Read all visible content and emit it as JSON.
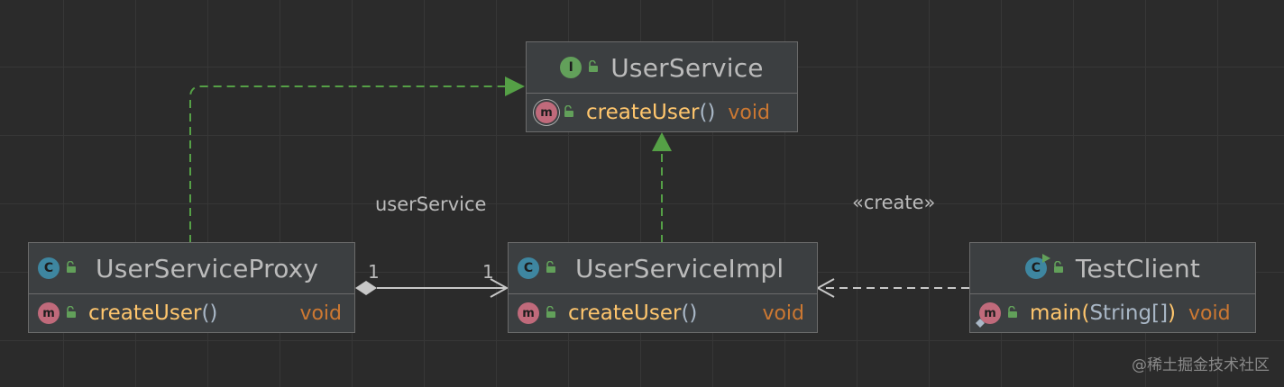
{
  "nodes": {
    "userService": {
      "title": "UserService",
      "badge": "I",
      "method": {
        "badge": "m",
        "name": "createUser",
        "params": "()",
        "type": "void"
      }
    },
    "proxy": {
      "title": "UserServiceProxy",
      "badge": "C",
      "method": {
        "badge": "m",
        "name": "createUser",
        "params": "()",
        "type": "void"
      }
    },
    "impl": {
      "title": "UserServiceImpl",
      "badge": "C",
      "method": {
        "badge": "m",
        "name": "createUser",
        "params": "()",
        "type": "void"
      }
    },
    "client": {
      "title": "TestClient",
      "badge": "C",
      "method": {
        "badge": "m",
        "name": "main",
        "params_open": "(",
        "params_type": "String[]",
        "params_close": ")",
        "type": "void"
      }
    }
  },
  "edges": {
    "association_label": "userService",
    "association_source_multiplicity": "1",
    "association_target_multiplicity": "1",
    "dependency_label": "«create»"
  },
  "watermark": "@稀土掘金技术社区",
  "colors": {
    "realization": "#55a046",
    "association": "#c8c8c8",
    "dependency": "#c8c8c8"
  }
}
